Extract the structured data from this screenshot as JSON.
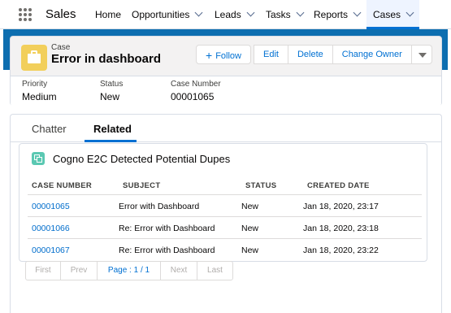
{
  "nav": {
    "app_name": "Sales",
    "items": [
      {
        "label": "Home"
      },
      {
        "label": "Opportunities"
      },
      {
        "label": "Leads"
      },
      {
        "label": "Tasks"
      },
      {
        "label": "Reports"
      },
      {
        "label": "Cases"
      }
    ]
  },
  "record": {
    "object_type": "Case",
    "title": "Error in dashboard",
    "actions": {
      "follow": "Follow",
      "edit": "Edit",
      "delete": "Delete",
      "change_owner": "Change Owner"
    },
    "fields": [
      {
        "label": "Priority",
        "value": "Medium"
      },
      {
        "label": "Status",
        "value": "New"
      },
      {
        "label": "Case Number",
        "value": "00001065"
      }
    ]
  },
  "tabs": [
    {
      "label": "Chatter"
    },
    {
      "label": "Related"
    }
  ],
  "related_list": {
    "title": "Cogno E2C Detected Potential Dupes",
    "columns": [
      "CASE NUMBER",
      "SUBJECT",
      "STATUS",
      "CREATED DATE"
    ],
    "rows": [
      {
        "case_number": "00001065",
        "subject": "Error with Dashboard",
        "status": "New",
        "created": "Jan 18, 2020, 23:17"
      },
      {
        "case_number": "00001066",
        "subject": "Re: Error with Dashboard",
        "status": "New",
        "created": "Jan 18, 2020, 23:18"
      },
      {
        "case_number": "00001067",
        "subject": "Re: Error with Dashboard",
        "status": "New",
        "created": "Jan 18, 2020, 23:22"
      }
    ]
  },
  "pagination": {
    "first": "First",
    "prev": "Prev",
    "page": "Page : 1 / 1",
    "next": "Next",
    "last": "Last"
  },
  "colors": {
    "accent": "#0070d2",
    "band": "#0d6eb0",
    "case_icon": "#f2cf5b",
    "list_icon": "#5bc8b2"
  }
}
